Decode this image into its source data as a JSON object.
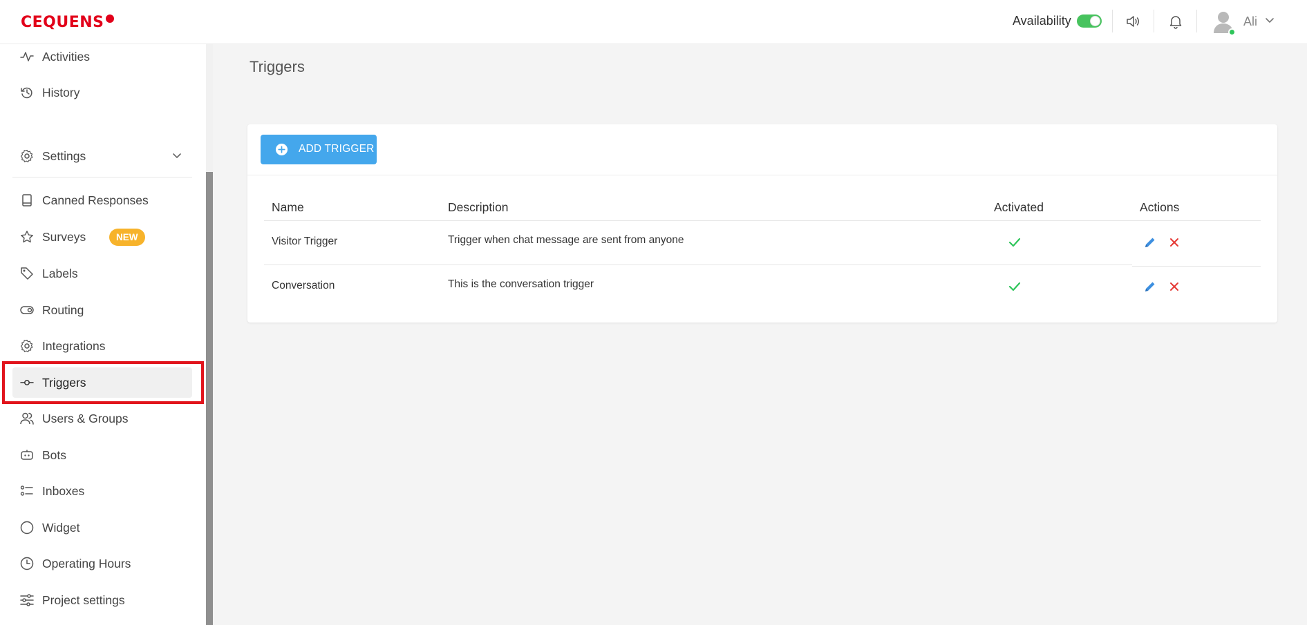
{
  "brand": {
    "name": "CEQUENS",
    "color": "#e2001a"
  },
  "header": {
    "availability_label": "Availability",
    "availability_on": true,
    "user_name": "Ali",
    "icons": [
      "speaker-icon",
      "bell-icon",
      "avatar-icon",
      "chevron-down-icon"
    ]
  },
  "sidebar": {
    "items": [
      {
        "label": "Activities",
        "icon": "activity-icon"
      },
      {
        "label": "History",
        "icon": "history-icon"
      },
      {
        "label": "Settings",
        "icon": "gear-icon",
        "expandable": true
      },
      {
        "label": "Canned Responses",
        "icon": "book-icon"
      },
      {
        "label": "Surveys",
        "icon": "star-icon",
        "badge": "NEW"
      },
      {
        "label": "Labels",
        "icon": "tag-icon"
      },
      {
        "label": "Routing",
        "icon": "toggle-icon"
      },
      {
        "label": "Integrations",
        "icon": "gear-icon"
      },
      {
        "label": "Triggers",
        "icon": "commit-icon",
        "active": true
      },
      {
        "label": "Users & Groups",
        "icon": "users-icon"
      },
      {
        "label": "Bots",
        "icon": "bot-icon"
      },
      {
        "label": "Inboxes",
        "icon": "list-icon"
      },
      {
        "label": "Widget",
        "icon": "circle-icon"
      },
      {
        "label": "Operating Hours",
        "icon": "clock-icon"
      },
      {
        "label": "Project settings",
        "icon": "sliders-icon"
      }
    ]
  },
  "main": {
    "title": "Triggers",
    "add_button_label": "ADD TRIGGER",
    "table": {
      "columns": [
        "Name",
        "Description",
        "Activated",
        "Actions"
      ],
      "rows": [
        {
          "name": "Visitor Trigger",
          "description": "Trigger when chat message are sent from anyone",
          "activated": true
        },
        {
          "name": "Conversation",
          "description": "This is the conversation trigger",
          "activated": true
        }
      ]
    }
  },
  "colors": {
    "accent": "#44a7ec",
    "success": "#2ec55a",
    "danger": "#e53935",
    "badge": "#f7b32b",
    "highlight": "#e1141c"
  }
}
